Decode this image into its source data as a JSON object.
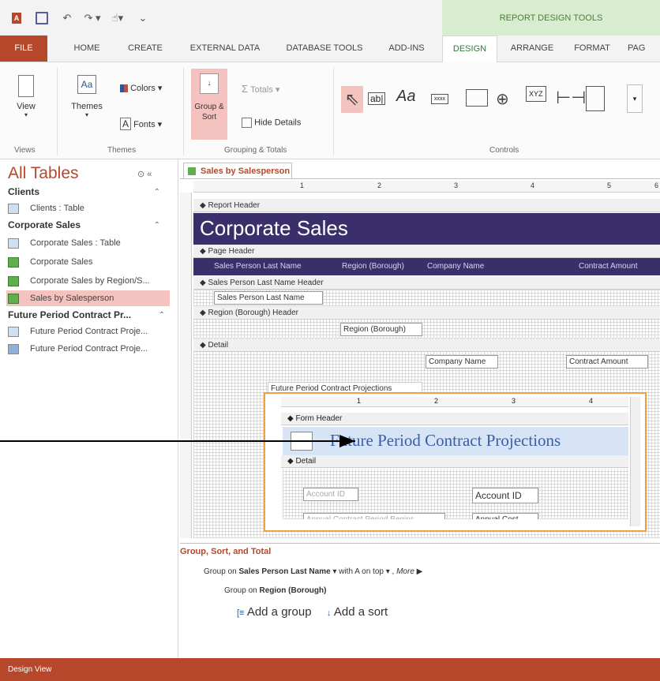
{
  "context_tab": "REPORT DESIGN TOOLS",
  "tabs": [
    "FILE",
    "HOME",
    "CREATE",
    "EXTERNAL DATA",
    "DATABASE TOOLS",
    "ADD-INS",
    "DESIGN",
    "ARRANGE",
    "FORMAT",
    "PAG"
  ],
  "ribbon": {
    "view": "View",
    "themes": "Themes",
    "colors": "Colors",
    "fonts": "Fonts",
    "group_sort": "Group & Sort",
    "totals": "Totals",
    "hide_details": "Hide Details",
    "groups": [
      "Views",
      "Themes",
      "Grouping & Totals",
      "Controls"
    ],
    "control_text": [
      "ab|",
      "Aa",
      "xxxx",
      "XYZ"
    ]
  },
  "nav": {
    "title": "All Tables",
    "groups": [
      {
        "name": "Clients",
        "items": [
          {
            "label": "Clients : Table",
            "type": "table"
          }
        ]
      },
      {
        "name": "Corporate Sales",
        "items": [
          {
            "label": "Corporate Sales : Table",
            "type": "table"
          },
          {
            "label": "Corporate Sales",
            "type": "report"
          },
          {
            "label": "Corporate Sales by Region/S...",
            "type": "report"
          },
          {
            "label": "Sales by Salesperson",
            "type": "report",
            "selected": true
          }
        ]
      },
      {
        "name": "Future Period Contract Pr...",
        "items": [
          {
            "label": "Future Period Contract Proje...",
            "type": "table"
          },
          {
            "label": "Future Period Contract Proje...",
            "type": "form"
          }
        ]
      }
    ]
  },
  "doc": {
    "tab": "Sales by Salesperson",
    "ruler": [
      "1",
      "2",
      "3",
      "4",
      "5",
      "6"
    ],
    "sections": {
      "report_header": "Report Header",
      "page_header": "Page Header",
      "sp_header": "Sales Person Last Name Header",
      "region_header": "Region (Borough) Header",
      "detail": "Detail"
    },
    "title": "Corporate Sales",
    "page_cols": [
      "Sales Person Last Name",
      "Region (Borough)",
      "Company Name",
      "Contract Amount"
    ],
    "sp_field": "Sales Person Last Name",
    "region_field": "Region (Borough)",
    "detail_fields": [
      "Company Name",
      "Contract Amount"
    ],
    "subform_label": "Future Period Contract Projections",
    "subform": {
      "ruler": [
        "1",
        "2",
        "3",
        "4"
      ],
      "form_header": "Form Header",
      "title": "Future Period Contract Projections",
      "detail": "Detail",
      "fields": [
        "Account ID",
        "Account ID",
        "Annual Contract Period Begins",
        "Annual Cost"
      ]
    }
  },
  "gsp": {
    "title": "Group, Sort, and Total",
    "row1_prefix": "Group on",
    "row1_field": "Sales Person Last Name",
    "row1_suffix": "with A on top",
    "row1_more": "More ▶",
    "row2_prefix": "Group on",
    "row2_field": "Region (Borough)",
    "add_group": "Add a group",
    "add_sort": "Add a sort"
  },
  "status": "Design View"
}
